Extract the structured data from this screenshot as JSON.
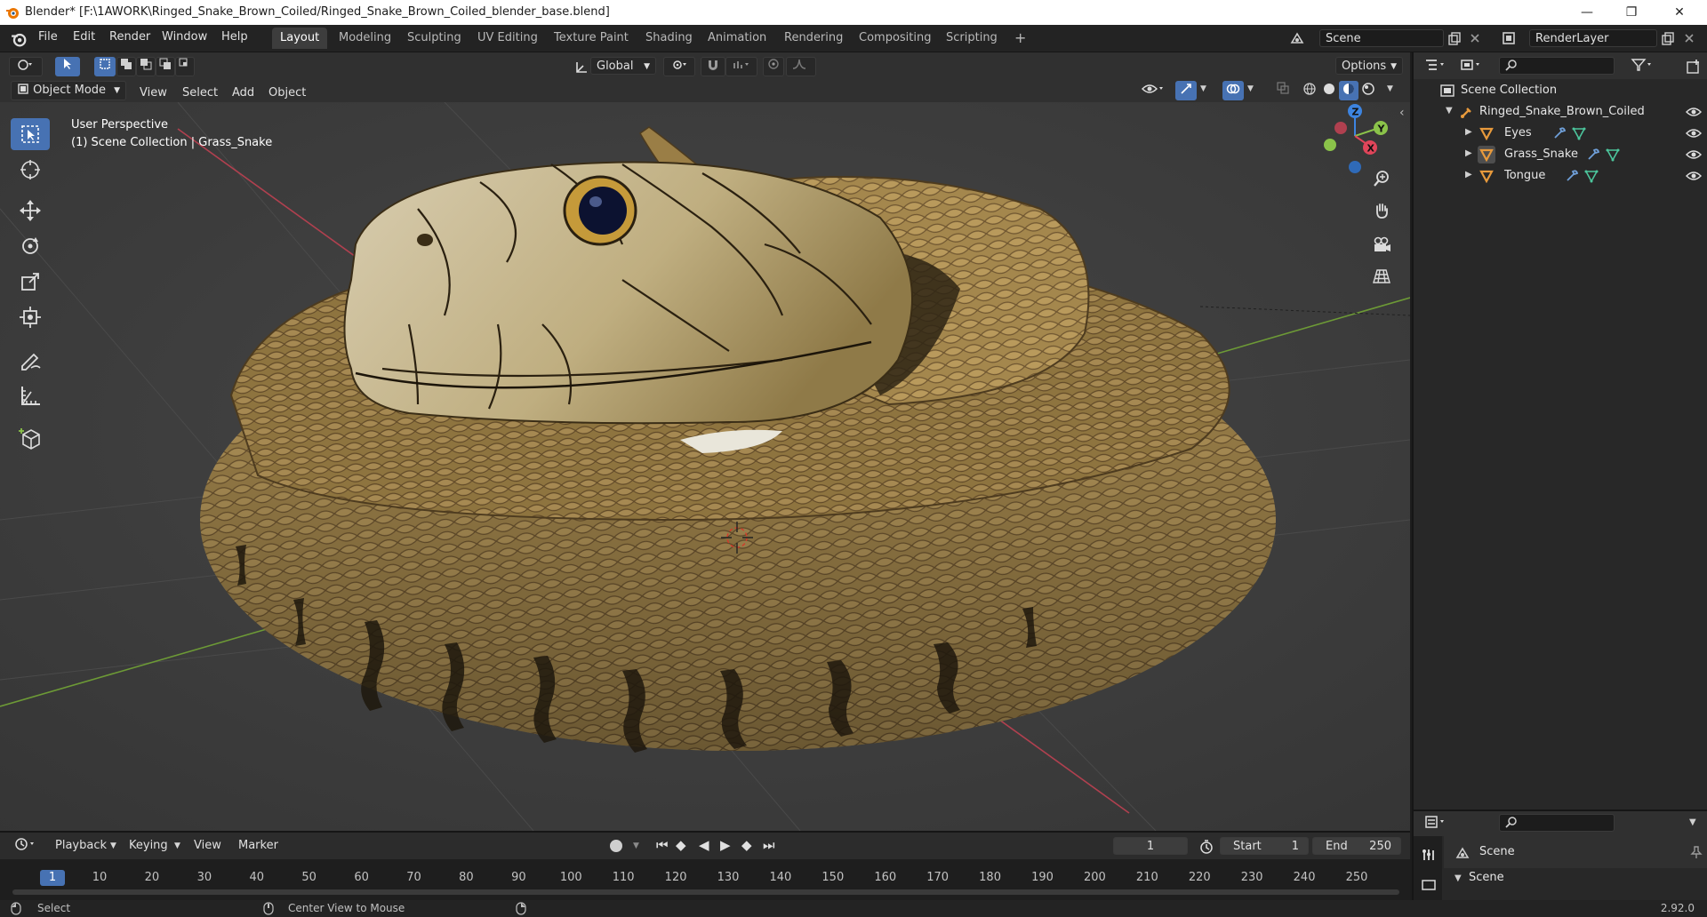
{
  "window": {
    "title": "Blender* [F:\\1AWORK\\Ringed_Snake_Brown_Coiled/Ringed_Snake_Brown_Coiled_blender_base.blend]",
    "controls": [
      "—",
      "❐",
      "✕"
    ]
  },
  "menu": [
    "File",
    "Edit",
    "Render",
    "Window",
    "Help"
  ],
  "workspaces": [
    "Layout",
    "Modeling",
    "Sculpting",
    "UV Editing",
    "Texture Paint",
    "Shading",
    "Animation",
    "Rendering",
    "Compositing",
    "Scripting"
  ],
  "workspace_add": "+",
  "scene_field": "Scene",
  "render_layer_field": "RenderLayer",
  "viewport_header": {
    "transform_orientation": "Global",
    "options_label": "Options",
    "mode": "Object Mode",
    "menus": [
      "View",
      "Select",
      "Add",
      "Object"
    ]
  },
  "viewport": {
    "perspective": "User Perspective",
    "collection_info": "(1) Scene Collection | Grass_Snake",
    "gizmo_axes": {
      "z": "Z",
      "y": "Y",
      "x": "X"
    }
  },
  "outliner": {
    "root": "Scene Collection",
    "collection": "Ringed_Snake_Brown_Coiled",
    "objects": [
      {
        "name": "Eyes"
      },
      {
        "name": "Grass_Snake"
      },
      {
        "name": "Tongue"
      }
    ]
  },
  "properties": {
    "scene_title": "Scene",
    "section": "Scene"
  },
  "timeline": {
    "menus": [
      "Playback",
      "Keying",
      "View",
      "Marker"
    ],
    "current_frame": "1",
    "start_label": "Start",
    "start_value": "1",
    "end_label": "End",
    "end_value": "250",
    "ticks": [
      "1",
      "10",
      "20",
      "30",
      "40",
      "50",
      "60",
      "70",
      "80",
      "90",
      "100",
      "110",
      "120",
      "130",
      "140",
      "150",
      "160",
      "170",
      "180",
      "190",
      "200",
      "210",
      "220",
      "230",
      "240",
      "250"
    ]
  },
  "status": {
    "select": "Select",
    "center_view": "Center View to Mouse",
    "version": "2.92.0"
  },
  "colors": {
    "accent": "#4772b3",
    "axis_x": "#e0455a",
    "axis_y": "#8bc34a",
    "axis_z": "#3d84e0",
    "snake_body": "#a0834a",
    "snake_head": "#c4b38a"
  }
}
